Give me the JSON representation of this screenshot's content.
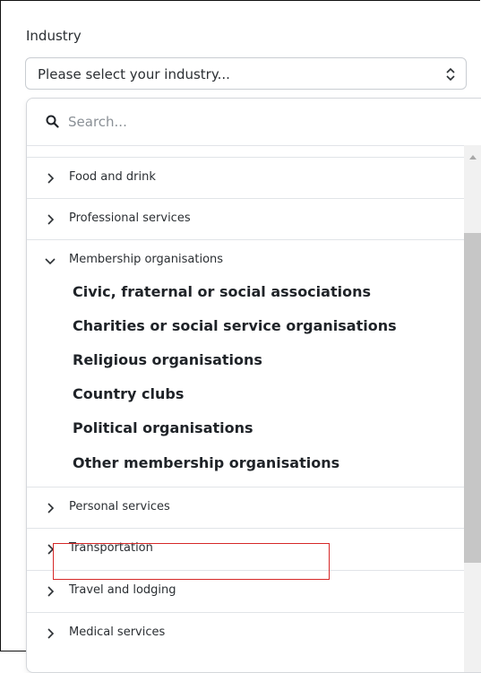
{
  "field": {
    "label": "Industry",
    "select_value": "Please select your industry..."
  },
  "dropdown": {
    "search_placeholder": "Search...",
    "categories": [
      {
        "label": "Food and drink",
        "expanded": false
      },
      {
        "label": "Professional services",
        "expanded": false
      },
      {
        "label": "Membership organisations",
        "expanded": true
      },
      {
        "label": "Personal services",
        "expanded": false
      },
      {
        "label": "Transportation",
        "expanded": false
      },
      {
        "label": "Travel and lodging",
        "expanded": false
      },
      {
        "label": "Medical services",
        "expanded": false
      }
    ],
    "membership_subitems": [
      "Civic, fraternal or social associations",
      "Charities or social service organisations",
      "Religious organisations",
      "Country clubs",
      "Political organisations",
      "Other membership organisations"
    ],
    "highlighted_item": "Other membership organisations"
  },
  "colors": {
    "highlight_border": "#d62828",
    "scrollbar_thumb": "#c6c6c6"
  }
}
